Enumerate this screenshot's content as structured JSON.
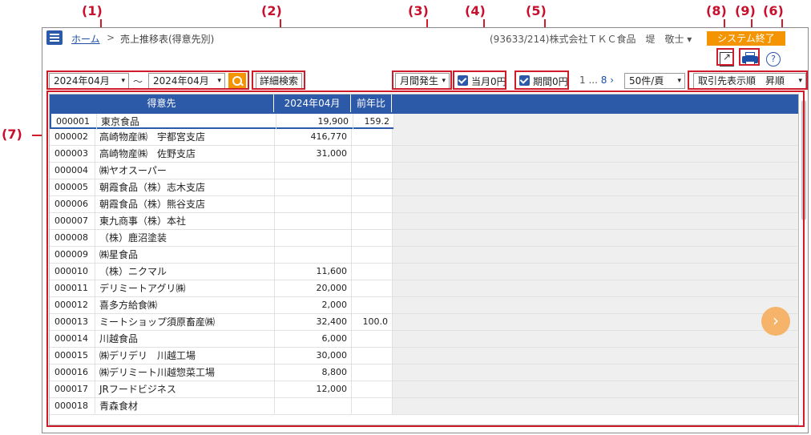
{
  "annotations": [
    "(1)",
    "(2)",
    "(3)",
    "(4)",
    "(5)",
    "(8)",
    "(9)",
    "(6)",
    "(7)"
  ],
  "header": {
    "home_link": "ホーム",
    "separator": ">",
    "page_title": "売上推移表(得意先別)",
    "user_info": "(93633/214)株式会社ＴＫＣ食品　堤　敬士 ▾",
    "exit_button": "システム終了",
    "avatar_glyph": "ご"
  },
  "icons": {
    "help_glyph": "?",
    "accent_color": "#f39400",
    "brand_color": "#2d5aa8"
  },
  "toolbar": {
    "date_from": "2024年04月",
    "date_to": "2024年04月",
    "range_sep": "～",
    "detail_search": "詳細検索",
    "period_mode": "月間発生",
    "chk_current_label": "当月0円",
    "chk_period_label": "期間0円",
    "pager_current": "1",
    "pager_ellipsis": "...",
    "pager_last": "8",
    "pager_next": "›",
    "per_page": "50件/頁",
    "sort_order": "取引先表示順　昇順",
    "caret": "▾"
  },
  "table": {
    "headers": [
      "得意先",
      "2024年04月",
      "前年比"
    ],
    "rows": [
      {
        "code": "000001",
        "name": "東京食品",
        "amount": "19,900",
        "ratio": "159.2"
      },
      {
        "code": "000002",
        "name": "高崎物産㈱　宇都宮支店",
        "amount": "416,770",
        "ratio": ""
      },
      {
        "code": "000003",
        "name": "高崎物産㈱　佐野支店",
        "amount": "31,000",
        "ratio": ""
      },
      {
        "code": "000004",
        "name": "㈱ヤオスーパー",
        "amount": "",
        "ratio": ""
      },
      {
        "code": "000005",
        "name": "朝霞食品（株）志木支店",
        "amount": "",
        "ratio": ""
      },
      {
        "code": "000006",
        "name": "朝霞食品（株）熊谷支店",
        "amount": "",
        "ratio": ""
      },
      {
        "code": "000007",
        "name": "東九商事（株）本社",
        "amount": "",
        "ratio": ""
      },
      {
        "code": "000008",
        "name": "（株）鹿沼塗装",
        "amount": "",
        "ratio": ""
      },
      {
        "code": "000009",
        "name": "㈱星食品",
        "amount": "",
        "ratio": ""
      },
      {
        "code": "000010",
        "name": "（株）ニクマル",
        "amount": "11,600",
        "ratio": ""
      },
      {
        "code": "000011",
        "name": "デリミートアグリ㈱",
        "amount": "20,000",
        "ratio": ""
      },
      {
        "code": "000012",
        "name": "喜多方給食㈱",
        "amount": "2,000",
        "ratio": ""
      },
      {
        "code": "000013",
        "name": "ミートショップ須原畜産㈱",
        "amount": "32,400",
        "ratio": "100.0"
      },
      {
        "code": "000014",
        "name": "川越食品",
        "amount": "6,000",
        "ratio": ""
      },
      {
        "code": "000015",
        "name": "㈱デリデリ　川越工場",
        "amount": "30,000",
        "ratio": ""
      },
      {
        "code": "000016",
        "name": "㈱デリミート川越惣菜工場",
        "amount": "8,800",
        "ratio": ""
      },
      {
        "code": "000017",
        "name": "JRフードビジネス",
        "amount": "12,000",
        "ratio": ""
      },
      {
        "code": "000018",
        "name": "青森食材",
        "amount": "",
        "ratio": ""
      }
    ]
  },
  "next_glyph": "›"
}
